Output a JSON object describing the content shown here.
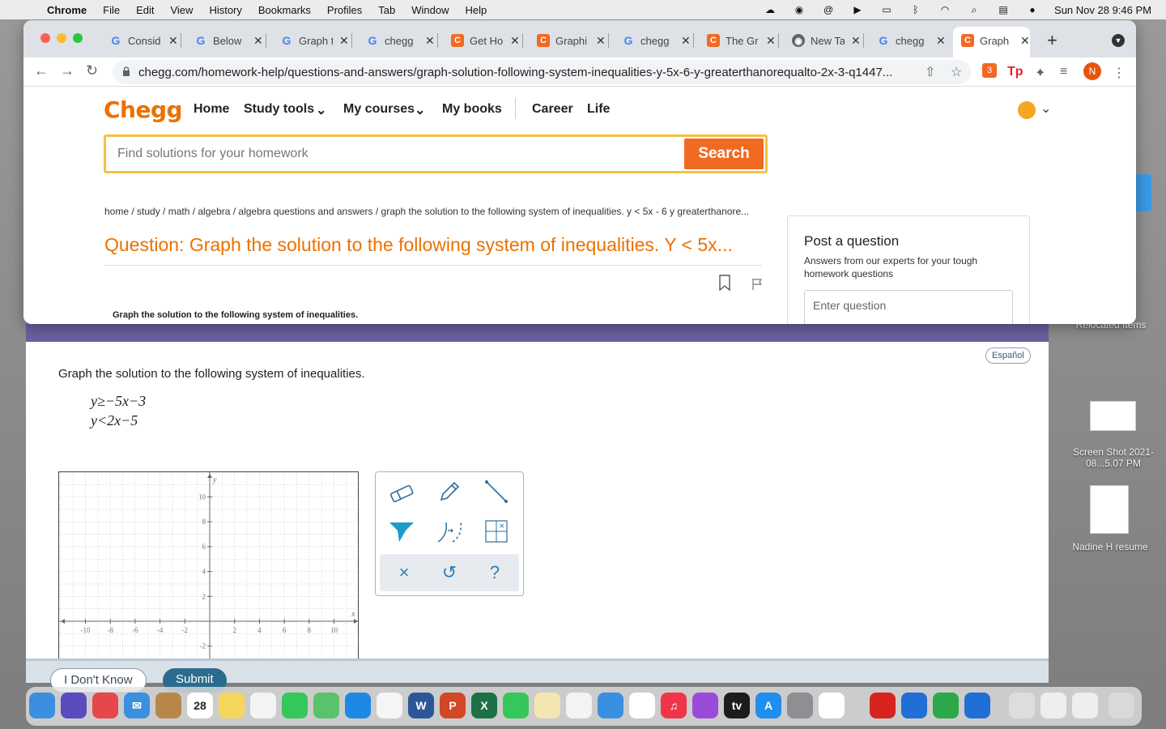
{
  "menubar": {
    "app": "Chrome",
    "items": [
      "File",
      "Edit",
      "View",
      "History",
      "Bookmarks",
      "Profiles",
      "Tab",
      "Window",
      "Help"
    ],
    "clock": "Sun Nov 28  9:46 PM"
  },
  "desktop": {
    "icons": [
      {
        "label": "Relocated Items"
      },
      {
        "label": "Screen Shot 2021-08...5.07 PM"
      },
      {
        "label": "Nadine H resume"
      }
    ]
  },
  "chrome": {
    "tabs": [
      {
        "label": "Consid",
        "icon": "google-icon"
      },
      {
        "label": "Below",
        "icon": "google-icon"
      },
      {
        "label": "Graph t",
        "icon": "google-icon"
      },
      {
        "label": "chegg",
        "icon": "google-icon"
      },
      {
        "label": "Get Ho",
        "icon": "chegg-icon"
      },
      {
        "label": "Graphi",
        "icon": "chegg-icon"
      },
      {
        "label": "chegg",
        "icon": "google-icon"
      },
      {
        "label": "The Gr",
        "icon": "chegg-icon"
      },
      {
        "label": "New Ta",
        "icon": "chrome-icon"
      },
      {
        "label": "chegg",
        "icon": "google-icon"
      }
    ],
    "active_tab": "Graph",
    "url": "chegg.com/homework-help/questions-and-answers/graph-solution-following-system-inequalities-y-5x-6-y-greaterthanorequalto-2x-3-q1447...",
    "profile_initial": "N",
    "ext_badge": "3"
  },
  "chegg": {
    "logo": "Chegg",
    "nav": [
      "Home",
      "Study tools",
      "My courses",
      "My books",
      "Career",
      "Life"
    ],
    "search_placeholder": "Find solutions for your homework",
    "search_button": "Search",
    "breadcrumb": "home / study / math / algebra / algebra questions and answers / graph the solution to the following system of inequalities. y < 5x - 6 y greaterthanore...",
    "question_title": "Question: Graph the solution to the following system of inequalities. Y < 5x...",
    "question_snippet": "Graph the solution to the following system of inequalities.",
    "post_question": {
      "heading": "Post a question",
      "subtext": "Answers from our experts for your tough homework questions",
      "placeholder": "Enter question"
    }
  },
  "assessment": {
    "espanol": "Español",
    "prompt": "Graph the solution to the following system of inequalities.",
    "inequality_1": "y≥−5x−3",
    "inequality_2": "y<2x−5",
    "graph": {
      "x_label": "x",
      "y_label": "y",
      "x_ticks": [
        "-10",
        "-8",
        "-6",
        "-4",
        "-2",
        "2",
        "4",
        "6",
        "8",
        "10"
      ],
      "y_ticks": [
        "10",
        "8",
        "6",
        "4",
        "2",
        "-2"
      ]
    },
    "tools": [
      "eraser",
      "pencil",
      "line",
      "fill",
      "dashed-curve",
      "grid-clear"
    ],
    "actions": {
      "clear": "×",
      "undo": "↺",
      "help": "?"
    },
    "buttons": {
      "dont_know": "I Don't Know",
      "submit": "Submit"
    }
  }
}
